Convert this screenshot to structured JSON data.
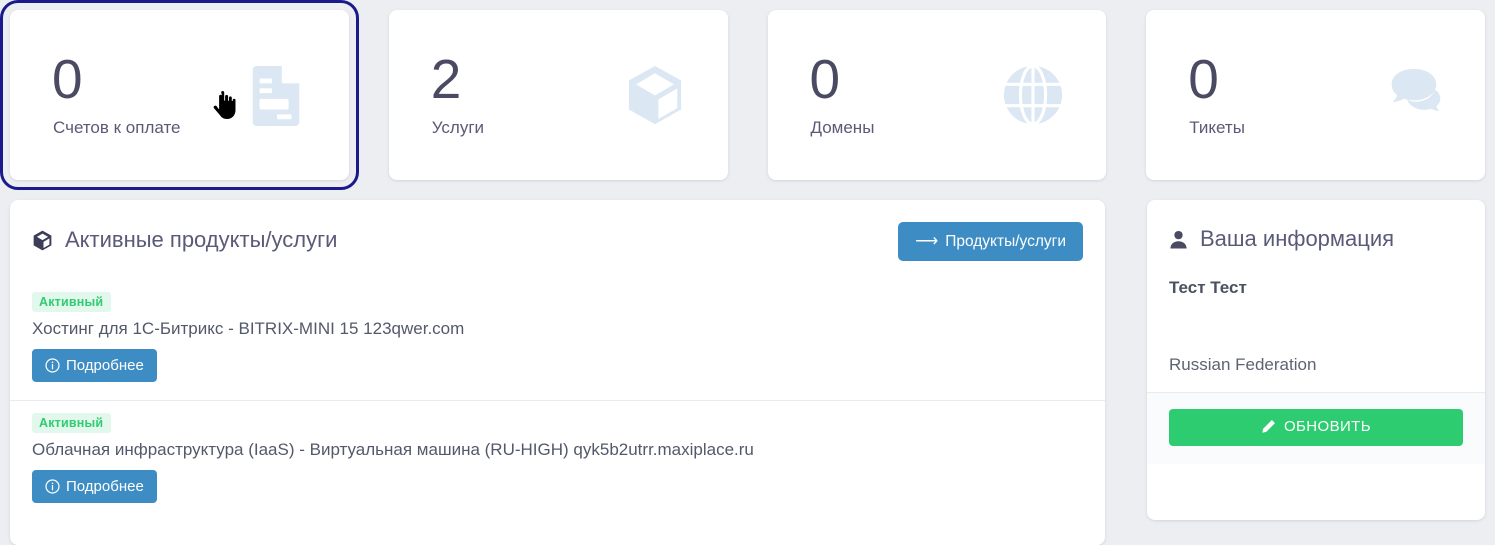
{
  "colors": {
    "page_bg": "#eceef2",
    "card_bg": "#ffffff",
    "focus_outline": "#1a1a8c",
    "stat_icon": "#dbe7f2",
    "accent_blue": "#3d8dc4",
    "accent_green": "#2ecc71",
    "badge_bg": "#e2f8ec",
    "badge_text": "#2fcc71",
    "heading_text": "#5a5a78",
    "number_text": "#4a4a63"
  },
  "stats": [
    {
      "value": "0",
      "label": "Счетов к оплате",
      "icon": "invoice-document-icon",
      "focused": true
    },
    {
      "value": "2",
      "label": "Услуги",
      "icon": "box-cube-icon",
      "focused": false
    },
    {
      "value": "0",
      "label": "Домены",
      "icon": "globe-icon",
      "focused": false
    },
    {
      "value": "0",
      "label": "Тикеты",
      "icon": "chat-bubbles-icon",
      "focused": false
    }
  ],
  "cursor": {
    "icon": "pointing-hand-cursor"
  },
  "main_panel": {
    "title": "Активные продукты/услуги",
    "title_icon": "box-cube-icon",
    "action_button": {
      "label": "Продукты/услуги",
      "icon": "arrow-right-icon"
    },
    "products": [
      {
        "status": "Активный",
        "name": "Хостинг для 1С-Битрикс - BITRIX-MINI 15 123qwer.com",
        "details_button": {
          "label": "Подробнее",
          "icon": "info-circle-icon"
        }
      },
      {
        "status": "Активный",
        "name": "Облачная инфраструктура (IaaS) - Виртуальная машина (RU-HIGH) qyk5b2utrr.maxiplace.ru",
        "details_button": {
          "label": "Подробнее",
          "icon": "info-circle-icon"
        }
      }
    ]
  },
  "side_panel": {
    "title": "Ваша информация",
    "title_icon": "person-icon",
    "name": "Тест Тест",
    "country": "Russian Federation",
    "update_button": {
      "label": "ОБНОВИТЬ",
      "icon": "pencil-icon"
    }
  }
}
